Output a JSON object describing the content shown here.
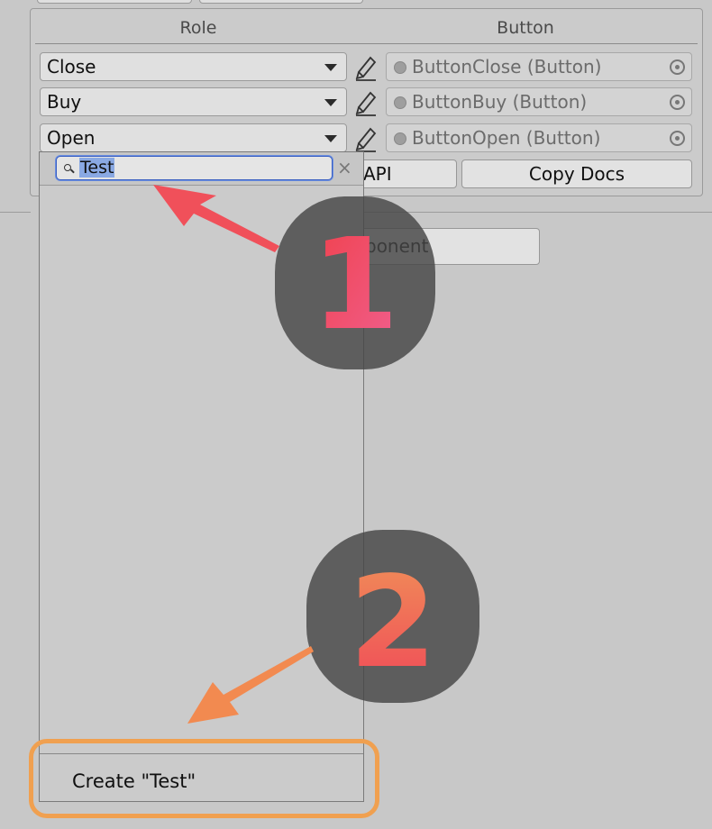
{
  "panel": {
    "headers": {
      "role": "Role",
      "button": "Button"
    },
    "rows": [
      {
        "role": "Close",
        "button": "ButtonClose (Button)"
      },
      {
        "role": "Buy",
        "button": "ButtonBuy (Button)"
      },
      {
        "role": "Open",
        "button": "ButtonOpen (Button)"
      }
    ],
    "buttons": {
      "api_partial": "API",
      "copy_docs": "Copy Docs"
    },
    "component_partial": "ponent"
  },
  "popup": {
    "search_value": "Test",
    "clear_symbol": "×",
    "create_label": "Create \"Test\""
  },
  "annotations": {
    "step1": "1",
    "step2": "2",
    "colors": {
      "step1_gradient": [
        "#f0404a",
        "#f06090"
      ],
      "step2_gradient": [
        "#f09058",
        "#f04858"
      ],
      "arrow1": "#f0505a",
      "arrow2": "#f28a50",
      "highlight_box": "#f0a050",
      "badge_bg": "#464646"
    }
  }
}
